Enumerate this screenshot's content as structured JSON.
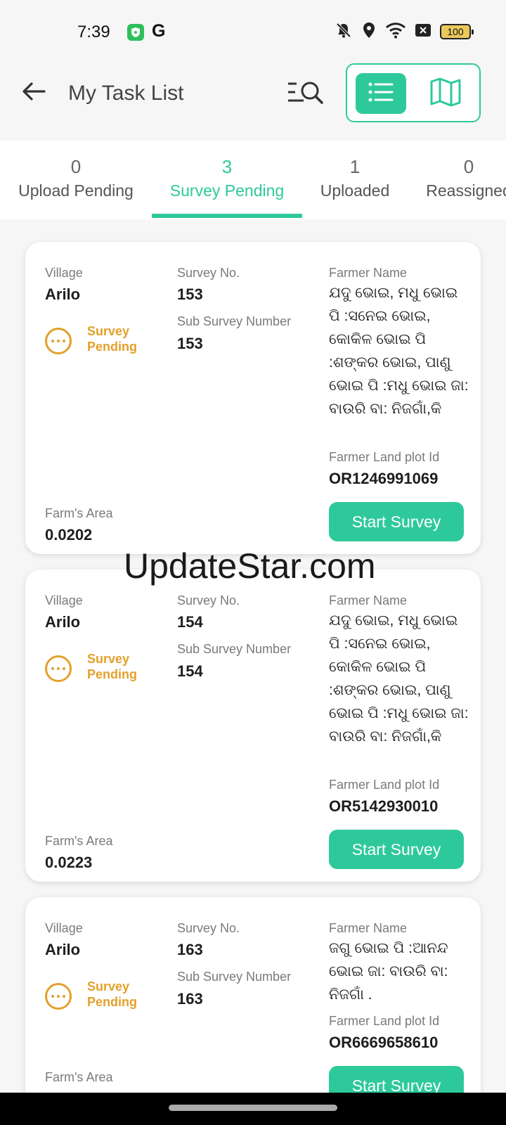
{
  "status_bar": {
    "time": "7:39",
    "icons": [
      "shield-icon",
      "google-icon",
      "mute-icon",
      "location-icon",
      "wifi-icon",
      "x-icon"
    ],
    "google_letter": "G",
    "battery": "100"
  },
  "header": {
    "title": "My Task List",
    "icons": [
      "back-arrow-icon",
      "filter-search-icon",
      "list-view-icon",
      "map-view-icon"
    ]
  },
  "tabs": [
    {
      "count": "0",
      "label": "Upload Pending",
      "active": false
    },
    {
      "count": "3",
      "label": "Survey Pending",
      "active": true
    },
    {
      "count": "1",
      "label": "Uploaded",
      "active": false
    },
    {
      "count": "0",
      "label": "Reassigned",
      "active": false
    }
  ],
  "labels": {
    "village": "Village",
    "survey_no": "Survey No.",
    "sub_survey_number": "Sub Survey Number",
    "farmer_name": "Farmer Name",
    "farmer_land_plot_id": "Farmer Land plot Id",
    "farms_area": "Farm's Area",
    "start_survey": "Start Survey",
    "status": "Survey Pending"
  },
  "cards": [
    {
      "village": "Arilo",
      "survey_no": "153",
      "sub_survey_number": "153",
      "farmer_name": "ଯଦୁ ଭୋଇ, ମଧୁ ଭୋଇ ପି :ସନେଇ ଭୋଇ, କୋକିଳ ଭୋଇ ପି :ଶଙ୍କର ଭୋଇ, ପାଣୁ ଭୋଇ ପି :ମଧୁ ଭୋଇ ଜା: ବାଉରି ବା: ନିଜଗାଁ,କି",
      "land_plot_id": "OR1246991069",
      "farms_area": "0.0202"
    },
    {
      "village": "Arilo",
      "survey_no": "154",
      "sub_survey_number": "154",
      "farmer_name": "ଯଦୁ ଭୋଇ, ମଧୁ ଭୋଇ ପି :ସନେଇ ଭୋଇ, କୋକିଳ ଭୋଇ ପି :ଶଙ୍କର ଭୋଇ, ପାଣୁ ଭୋଇ ପି :ମଧୁ ଭୋଇ ଜା: ବାଉରି ବା: ନିଜଗାଁ,କି",
      "land_plot_id": "OR5142930010",
      "farms_area": "0.0223"
    },
    {
      "village": "Arilo",
      "survey_no": "163",
      "sub_survey_number": "163",
      "farmer_name": "ଜଗୁ ଭୋଇ ପି :ଆନନ୍ଦ ଭୋଇ ଜା: ବାଉରି ବା: ନିଜଗାଁ .",
      "land_plot_id": "OR6669658610",
      "farms_area": ""
    }
  ],
  "watermark": "UpdateStar.com",
  "colors": {
    "accent": "#2ec99b",
    "pending": "#e3a02a",
    "background": "#f6f6f6"
  }
}
